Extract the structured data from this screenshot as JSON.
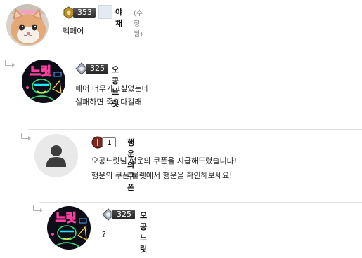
{
  "comments": [
    {
      "level": "353",
      "nickname": "야채",
      "edited_label": "(수정됨)",
      "lines": [
        "펙페어"
      ]
    },
    {
      "level": "325",
      "nickname": "오공느릿",
      "lines": [
        "페어 너무가고싶었는데",
        "실패하면 죽인다길래"
      ]
    },
    {
      "level": "1",
      "nickname": "행운의쿠폰",
      "lines": [
        "오공느릿님 행운의 쿠폰을 지급해드렸습니다!",
        "행운의 쿠폰 룰렛에서 행운을 확인해보세요!"
      ]
    },
    {
      "level": "325",
      "nickname": "오공느릿",
      "lines": [
        "?"
      ]
    }
  ],
  "icons": {
    "reply_arrow": "reply-arrow-icon",
    "default_avatar": "person-silhouette-icon"
  },
  "colors": {
    "divider": "#e2e2e2",
    "neon_pink": "#ff3fa0",
    "neon_green": "#35e07a"
  }
}
